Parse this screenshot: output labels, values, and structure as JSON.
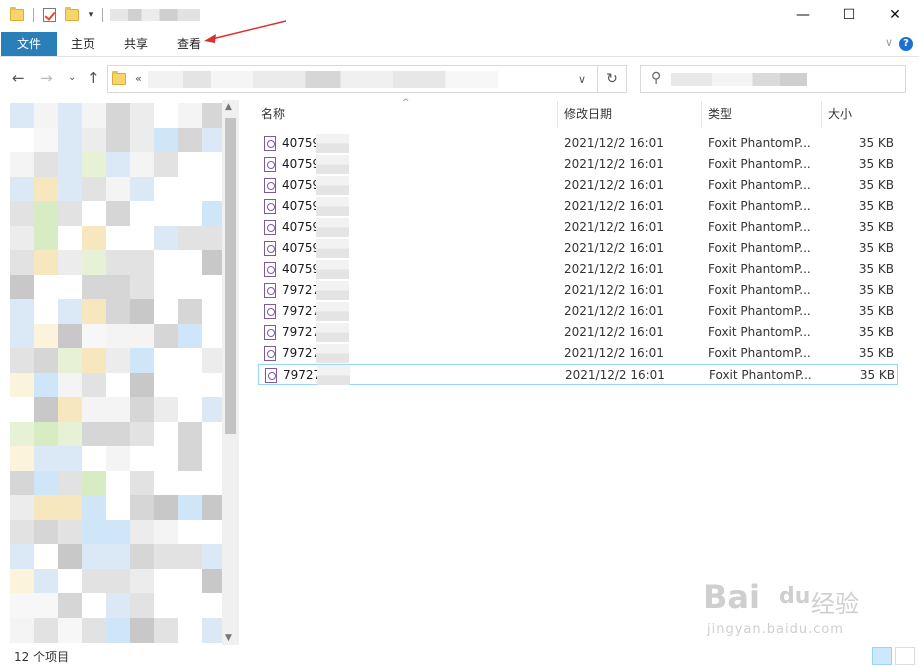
{
  "ribbon": {
    "tabs": [
      {
        "label": "文件"
      },
      {
        "label": "主页"
      },
      {
        "label": "共享"
      },
      {
        "label": "查看"
      }
    ]
  },
  "window": {
    "minimize": "—",
    "maximize": "☐",
    "close": "✕"
  },
  "address": {
    "chevron": "«"
  },
  "columns": {
    "name": "名称",
    "date": "修改日期",
    "type": "类型",
    "size": "大小"
  },
  "files": [
    {
      "name": "40759",
      "date": "2021/12/2 16:01",
      "type": "Foxit PhantomP...",
      "size": "35 KB"
    },
    {
      "name": "40759",
      "date": "2021/12/2 16:01",
      "type": "Foxit PhantomP...",
      "size": "35 KB"
    },
    {
      "name": "40759",
      "date": "2021/12/2 16:01",
      "type": "Foxit PhantomP...",
      "size": "35 KB"
    },
    {
      "name": "40759",
      "date": "2021/12/2 16:01",
      "type": "Foxit PhantomP...",
      "size": "35 KB"
    },
    {
      "name": "40759",
      "date": "2021/12/2 16:01",
      "type": "Foxit PhantomP...",
      "size": "35 KB"
    },
    {
      "name": "40759",
      "date": "2021/12/2 16:01",
      "type": "Foxit PhantomP...",
      "size": "35 KB"
    },
    {
      "name": "40759",
      "date": "2021/12/2 16:01",
      "type": "Foxit PhantomP...",
      "size": "35 KB"
    },
    {
      "name": "79727",
      "date": "2021/12/2 16:01",
      "type": "Foxit PhantomP...",
      "size": "35 KB"
    },
    {
      "name": "79727",
      "date": "2021/12/2 16:01",
      "type": "Foxit PhantomP...",
      "size": "35 KB"
    },
    {
      "name": "79727",
      "date": "2021/12/2 16:01",
      "type": "Foxit PhantomP...",
      "size": "35 KB"
    },
    {
      "name": "79727",
      "date": "2021/12/2 16:01",
      "type": "Foxit PhantomP...",
      "size": "35 KB"
    },
    {
      "name": "79727",
      "date": "2021/12/2 16:01",
      "type": "Foxit PhantomP...",
      "size": "35 KB"
    }
  ],
  "status": {
    "text": "12 个项目"
  },
  "watermark": {
    "brand": "Bai",
    "brand2": "du",
    "brand_cn": "经验",
    "url": "jingyan.baidu.com"
  },
  "colors": {
    "file_tab": "#2b7fb8",
    "selection_border": "#99d1ff",
    "annotation_arrow": "#d9322b"
  }
}
